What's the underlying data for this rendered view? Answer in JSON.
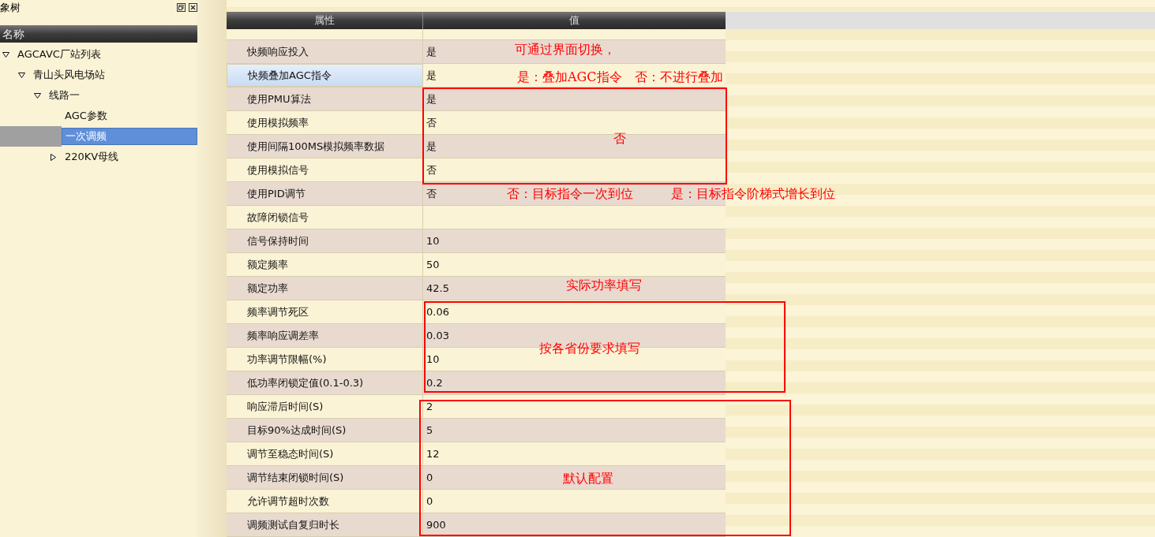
{
  "left_panel": {
    "title": "象树",
    "column_header": "名称",
    "tree": [
      {
        "label": "AGCAVC厂站列表",
        "expanded": true,
        "selected": false,
        "children": [
          {
            "label": "青山头风电场站",
            "expanded": true,
            "selected": false,
            "children": [
              {
                "label": "线路一",
                "expanded": true,
                "selected": false,
                "children": [
                  {
                    "label": "AGC参数",
                    "selected": false
                  },
                  {
                    "label": "一次调频",
                    "selected": true
                  },
                  {
                    "label": "220KV母线",
                    "expanded": false,
                    "selected": false
                  }
                ]
              }
            ]
          }
        ]
      }
    ]
  },
  "table": {
    "columns": [
      "属性",
      "值"
    ],
    "rows": [
      {
        "property": "快频响应投入",
        "value": "是",
        "selected": false
      },
      {
        "property": "快频叠加AGC指令",
        "value": "是",
        "selected": true
      },
      {
        "property": "使用PMU算法",
        "value": "是",
        "selected": false
      },
      {
        "property": "使用模拟频率",
        "value": "否",
        "selected": false
      },
      {
        "property": "使用间隔100MS模拟频率数据",
        "value": "是",
        "selected": false
      },
      {
        "property": "使用模拟信号",
        "value": "否",
        "selected": false
      },
      {
        "property": "使用PID调节",
        "value": "否",
        "selected": false
      },
      {
        "property": "故障闭锁信号",
        "value": "",
        "selected": false
      },
      {
        "property": "信号保持时间",
        "value": "10",
        "selected": false
      },
      {
        "property": "额定频率",
        "value": "50",
        "selected": false
      },
      {
        "property": "额定功率",
        "value": "42.5",
        "selected": false
      },
      {
        "property": "频率调节死区",
        "value": "0.06",
        "selected": false
      },
      {
        "property": "频率响应调差率",
        "value": "0.03",
        "selected": false
      },
      {
        "property": "功率调节限幅(%)",
        "value": "10",
        "selected": false
      },
      {
        "property": "低功率闭锁定值(0.1-0.3)",
        "value": "0.2",
        "selected": false
      },
      {
        "property": "响应滞后时间(S)",
        "value": "2",
        "selected": false
      },
      {
        "property": "目标90%达成时间(S)",
        "value": "5",
        "selected": false
      },
      {
        "property": "调节至稳态时间(S)",
        "value": "12",
        "selected": false
      },
      {
        "property": "调节结束闭锁时间(S)",
        "value": "0",
        "selected": false
      },
      {
        "property": "允许调节超时次数",
        "value": "0",
        "selected": false
      },
      {
        "property": "调频测试自复归时长",
        "value": "900",
        "selected": false
      }
    ]
  },
  "annotations": [
    {
      "kind": "note",
      "text": "可通过界面切换，"
    },
    {
      "kind": "note",
      "text": "是：叠加AGC指令　否：不进行叠加"
    },
    {
      "kind": "box"
    },
    {
      "kind": "note",
      "text": "否"
    },
    {
      "kind": "note",
      "text": "否：目标指令一次到位　　　是：目标指令阶梯式增长到位"
    },
    {
      "kind": "note",
      "text": "实际功率填写"
    },
    {
      "kind": "box"
    },
    {
      "kind": "note",
      "text": "按各省份要求填写"
    },
    {
      "kind": "box"
    },
    {
      "kind": "note",
      "text": "默认配置"
    }
  ]
}
